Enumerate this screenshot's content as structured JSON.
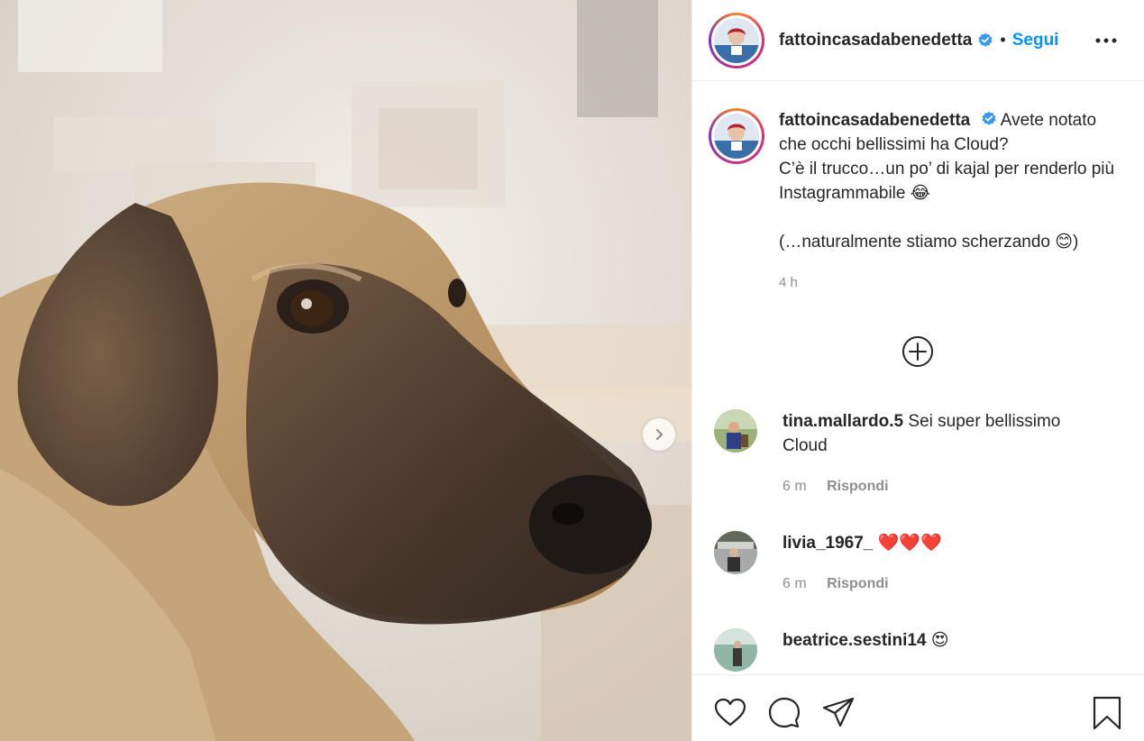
{
  "author": {
    "username": "fattoincasadabenedetta",
    "follow_label": "Segui",
    "separator": "•"
  },
  "caption": {
    "username": "fattoincasadabenedetta",
    "line1": "Avete notato che occhi bellissimi ha Cloud?",
    "line2": "C’è il trucco…un po’ di kajal per renderlo più Instagrammabile 😂",
    "line3": "(…naturalmente stiamo scherzando 😊)",
    "time": "4 h"
  },
  "comments": [
    {
      "username": "tina.mallardo.5",
      "text": "Sei super bellissimo Cloud",
      "time": "6 m",
      "reply_label": "Rispondi"
    },
    {
      "username": "livia_1967_",
      "text": "❤️❤️❤️",
      "time": "6 m",
      "reply_label": "Rispondi"
    },
    {
      "username": "beatrice.sestini14",
      "text": "😍"
    }
  ],
  "icons": {
    "verified": "verified-badge-icon",
    "more": "more-options-icon",
    "next": "chevron-right-icon",
    "load_more": "plus-circle-icon",
    "like": "heart-icon",
    "comment": "comment-bubble-icon",
    "share": "paper-plane-icon",
    "save": "bookmark-icon"
  },
  "colors": {
    "accent": "#0095f6",
    "secondary_text": "#8e8e8e",
    "text": "#262626",
    "verified": "#3897f0"
  }
}
